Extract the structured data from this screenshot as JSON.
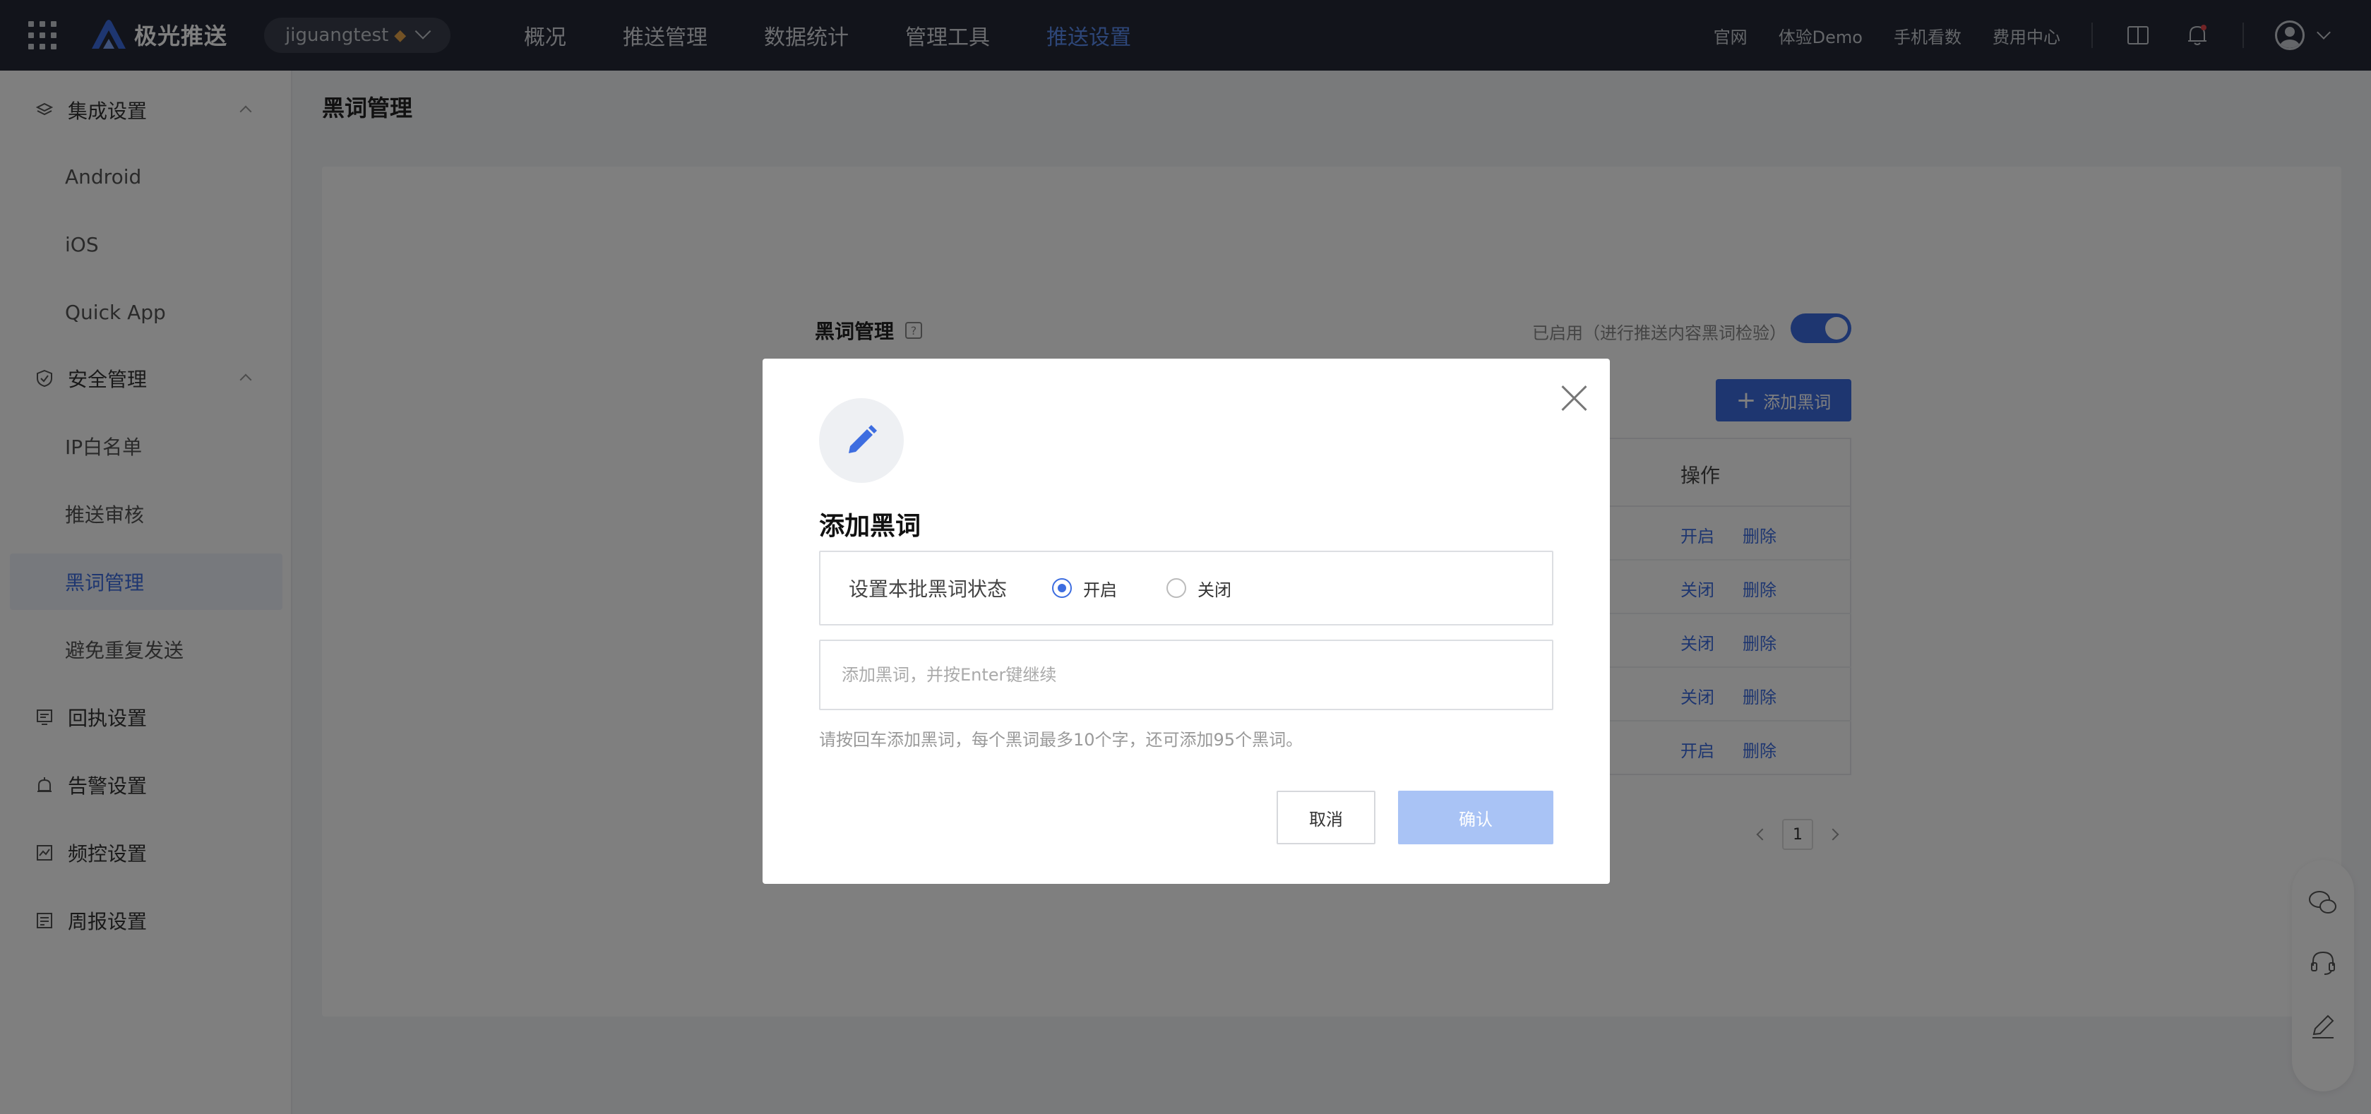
{
  "topbar": {
    "logo_text": "极光推送",
    "app_name": "jiguangtest",
    "main_nav": [
      "概况",
      "推送管理",
      "数据统计",
      "管理工具",
      "推送设置"
    ],
    "active_nav_index": 4,
    "right_links": [
      "官网",
      "体验Demo",
      "手机看数",
      "费用中心"
    ],
    "icons": [
      "apps-grid-icon",
      "book-icon",
      "bell-icon",
      "user-icon",
      "chevron-down-icon"
    ]
  },
  "sidebar": {
    "groups": [
      {
        "label": "集成设置",
        "icon": "layers-icon",
        "items": [
          "Android",
          "iOS",
          "Quick App"
        ]
      },
      {
        "label": "安全管理",
        "icon": "shield-icon",
        "items": [
          "IP白名单",
          "推送审核",
          "黑词管理",
          "避免重复发送"
        ]
      },
      {
        "label": "回执设置",
        "icon": "receipt-icon",
        "items": []
      },
      {
        "label": "告警设置",
        "icon": "alarm-icon",
        "items": []
      },
      {
        "label": "频控设置",
        "icon": "chart-icon",
        "items": []
      },
      {
        "label": "周报设置",
        "icon": "report-icon",
        "items": []
      }
    ],
    "active_item": "黑词管理"
  },
  "page": {
    "title": "黑词管理",
    "section_title": "黑词管理",
    "enabled_text": "已启用（进行推送内容黑词检验）",
    "toggle_on": true,
    "add_button": "添加黑词",
    "table_header_op": "操作",
    "rows": [
      {
        "toggle": "开启",
        "delete": "删除"
      },
      {
        "toggle": "关闭",
        "delete": "删除"
      },
      {
        "toggle": "关闭",
        "delete": "删除"
      },
      {
        "toggle": "关闭",
        "delete": "删除"
      },
      {
        "toggle": "开启",
        "delete": "删除"
      }
    ],
    "pagination_current": "1"
  },
  "modal": {
    "title": "添加黑词",
    "status_label": "设置本批黑词状态",
    "radio_on": "开启",
    "radio_off": "关闭",
    "selected": "开启",
    "input_placeholder": "添加黑词，并按Enter键继续",
    "input_value": "",
    "hint": "请按回车添加黑词，每个黑词最多10个字，还可添加95个黑词。",
    "cancel": "取消",
    "confirm": "确认"
  },
  "colors": {
    "topbar_bg": "#242936",
    "accent": "#3d6de0",
    "confirm_disabled": "#a9c3f5"
  }
}
